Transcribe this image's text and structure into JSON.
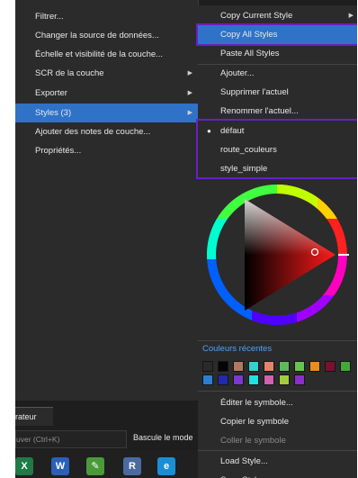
{
  "left_menu": {
    "items": [
      {
        "label": "Filtrer...",
        "arrow": ""
      },
      {
        "label": "Changer la source de données...",
        "arrow": ""
      },
      {
        "label": "Échelle et visibilité de la couche...",
        "arrow": ""
      },
      {
        "label": "SCR de la couche",
        "arrow": "▶"
      },
      {
        "label": "Exporter",
        "arrow": "▶"
      },
      {
        "label": "Styles (3)",
        "arrow": "▶"
      },
      {
        "label": "Ajouter des notes de couche...",
        "arrow": ""
      },
      {
        "label": "Propriétés...",
        "arrow": ""
      }
    ]
  },
  "style_menu": {
    "copy_current": "Copy Current Style",
    "copy_current_arrow": "▶",
    "copy_all": "Copy All Styles",
    "paste_all": "Paste All Styles",
    "add": "Ajouter...",
    "remove": "Supprimer l'actuel",
    "rename": "Renommer l'actuel...",
    "styles": [
      "défaut",
      "route_couleurs",
      "style_simple"
    ],
    "active_bullet": "●",
    "recent_colors_label": "Couleurs récentes",
    "recent_colors": [
      "#2a2a2a",
      "#050505",
      "#b07a60",
      "#2fd3cc",
      "#e5836a",
      "#5fb85a",
      "#67c34f",
      "#f08a19",
      "#7a1030",
      "#42a83a",
      "#2a7fd0",
      "#202ab0",
      "#7a3ad0",
      "#20e0e0",
      "#d062b0",
      "#a2cc3a",
      "#8a2fc8"
    ],
    "edit_symbol": "Éditer le symbole...",
    "copy_symbol": "Copier le symbole",
    "paste_symbol": "Coller le symbole",
    "load_style": "Load Style...",
    "save_style": "Save Style..."
  },
  "bottom_panel": {
    "tab_label": "rateur",
    "search_placeholder": "uver (Ctrl+K)",
    "toggle_label": "Bascule le mode"
  },
  "taskbar": {
    "icons": [
      {
        "name": "excel-icon",
        "glyph": "X",
        "color": "#1f7a45"
      },
      {
        "name": "word-icon",
        "glyph": "W",
        "color": "#2b5fb8"
      },
      {
        "name": "notepad-icon",
        "glyph": "✎",
        "color": "#4a9a3a"
      },
      {
        "name": "r-icon",
        "glyph": "R",
        "color": "#4a6aa0"
      },
      {
        "name": "edge-icon",
        "glyph": "e",
        "color": "#1a8fd6"
      }
    ]
  }
}
